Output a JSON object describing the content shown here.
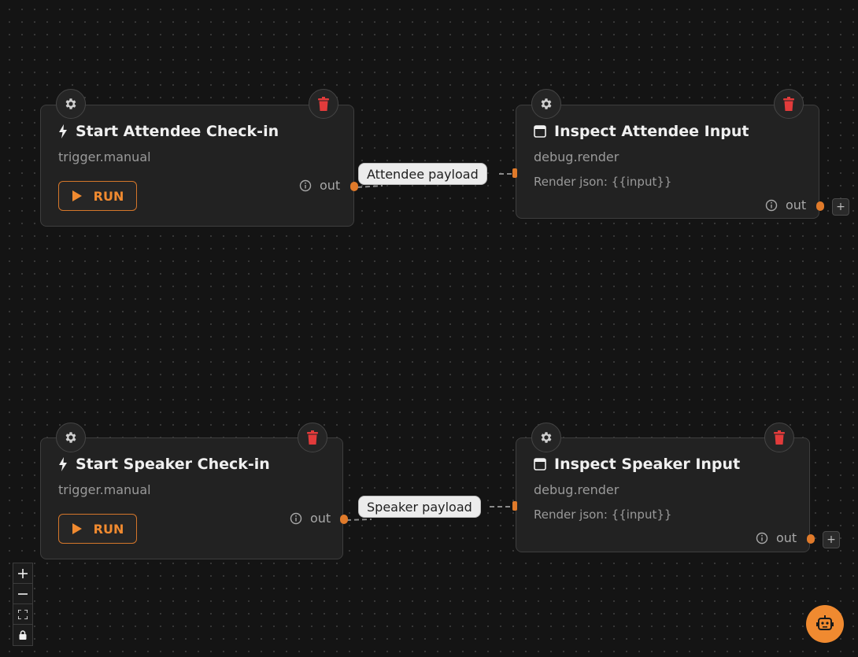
{
  "nodes": [
    {
      "title": "Start Attendee Check-in",
      "subtitle": "trigger.manual",
      "run_label": "RUN",
      "out_label": "out",
      "icon": "bolt-icon"
    },
    {
      "title": "Inspect Attendee Input",
      "subtitle": "debug.render",
      "detail": "Render json: {{input}}",
      "out_label": "out",
      "icon": "window-icon"
    },
    {
      "title": "Start Speaker Check-in",
      "subtitle": "trigger.manual",
      "run_label": "RUN",
      "out_label": "out",
      "icon": "bolt-icon"
    },
    {
      "title": "Inspect Speaker Input",
      "subtitle": "debug.render",
      "detail": "Render json: {{input}}",
      "out_label": "out",
      "icon": "window-icon"
    }
  ],
  "edges": [
    {
      "label": "Attendee payload"
    },
    {
      "label": "Speaker payload"
    }
  ],
  "controls": {
    "zoom_in": "+",
    "add_label": "+"
  },
  "colors": {
    "accent": "#f08a30",
    "delete": "#e23b3b",
    "background": "#141414"
  }
}
